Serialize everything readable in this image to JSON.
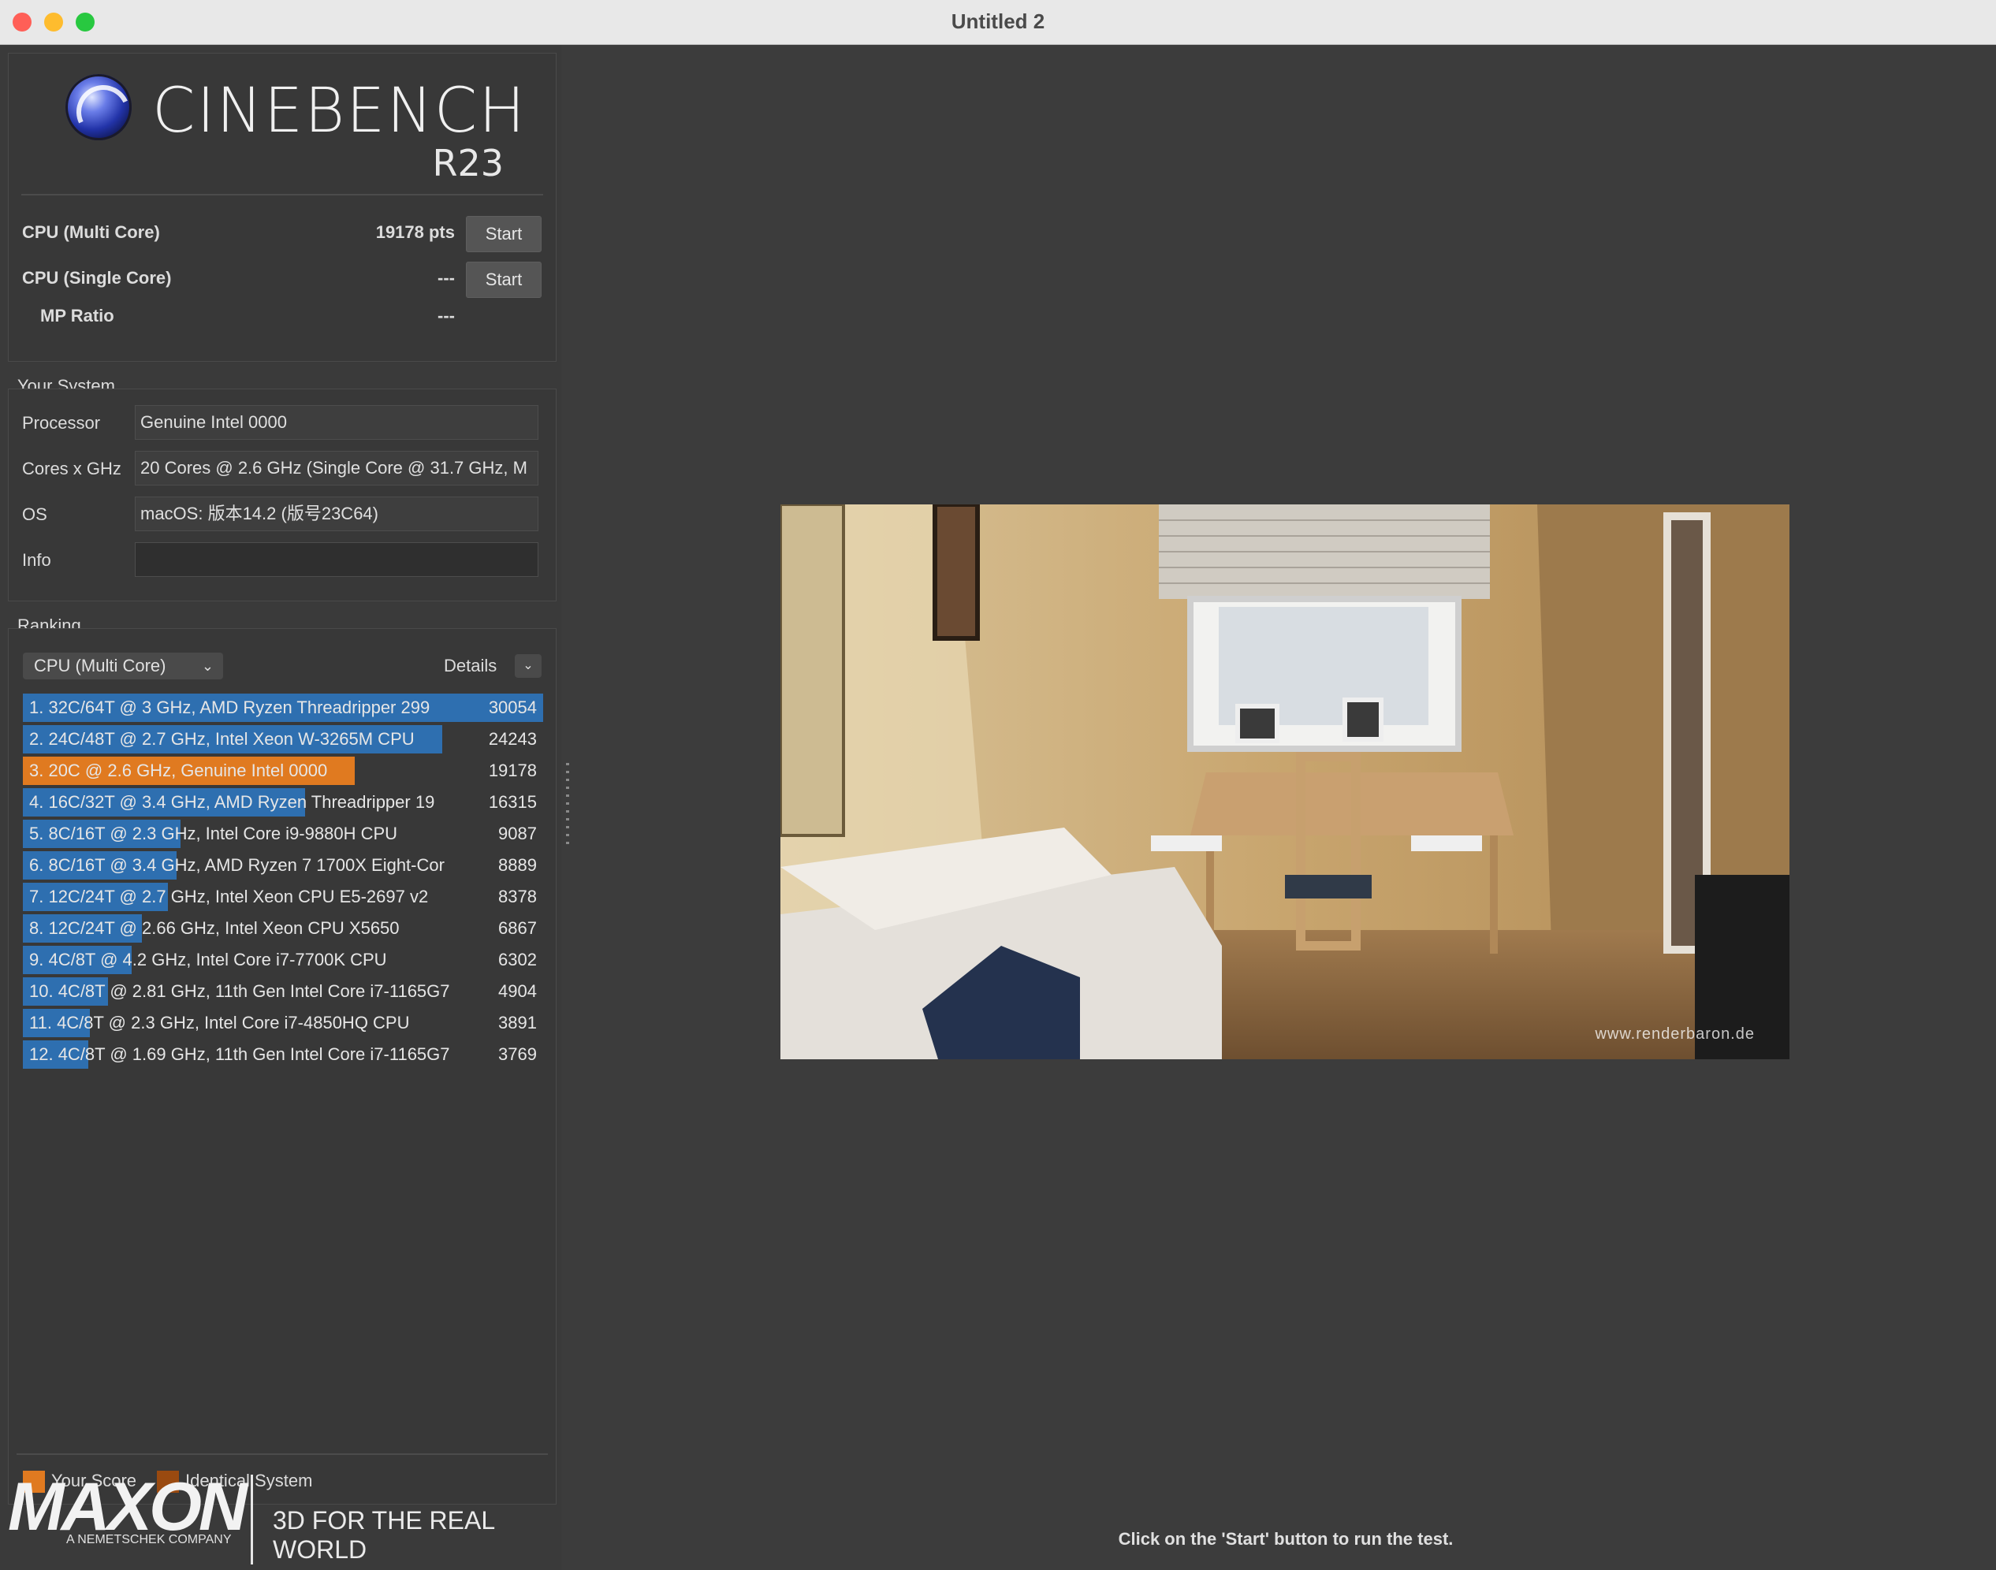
{
  "window": {
    "title": "Untitled 2"
  },
  "header": {
    "app_name": "CINEBENCH",
    "version": "R23"
  },
  "tests": {
    "multi": {
      "label": "CPU (Multi Core)",
      "value": "19178 pts",
      "button": "Start"
    },
    "single": {
      "label": "CPU (Single Core)",
      "value": "---",
      "button": "Start"
    },
    "mp_ratio": {
      "label": "MP Ratio",
      "value": "---"
    }
  },
  "system": {
    "title": "Your System",
    "fields": [
      {
        "label": "Processor",
        "value": "Genuine Intel 0000"
      },
      {
        "label": "Cores x GHz",
        "value": "20 Cores @ 2.6 GHz (Single Core @ 31.7 GHz, M"
      },
      {
        "label": "OS",
        "value": "macOS: 版本14.2 (版号23C64)"
      },
      {
        "label": "Info",
        "value": ""
      }
    ]
  },
  "ranking": {
    "title": "Ranking",
    "dropdown": "CPU (Multi Core)",
    "details_label": "Details",
    "max_score": 30054,
    "rows": [
      {
        "name": "1. 32C/64T @ 3 GHz, AMD Ryzen Threadripper 299",
        "score": 30054,
        "kind": "blue"
      },
      {
        "name": "2. 24C/48T @ 2.7 GHz, Intel Xeon W-3265M CPU",
        "score": 24243,
        "kind": "blue"
      },
      {
        "name": "3. 20C @ 2.6 GHz, Genuine Intel 0000",
        "score": 19178,
        "kind": "orange"
      },
      {
        "name": "4. 16C/32T @ 3.4 GHz, AMD Ryzen Threadripper 19",
        "score": 16315,
        "kind": "blue"
      },
      {
        "name": "5. 8C/16T @ 2.3 GHz, Intel Core i9-9880H CPU",
        "score": 9087,
        "kind": "blue"
      },
      {
        "name": "6. 8C/16T @ 3.4 GHz, AMD Ryzen 7 1700X Eight-Cor",
        "score": 8889,
        "kind": "blue"
      },
      {
        "name": "7. 12C/24T @ 2.7 GHz, Intel Xeon CPU E5-2697 v2",
        "score": 8378,
        "kind": "blue"
      },
      {
        "name": "8. 12C/24T @ 2.66 GHz, Intel Xeon CPU X5650",
        "score": 6867,
        "kind": "blue"
      },
      {
        "name": "9. 4C/8T @ 4.2 GHz, Intel Core i7-7700K CPU",
        "score": 6302,
        "kind": "blue"
      },
      {
        "name": "10. 4C/8T @ 2.81 GHz, 11th Gen Intel Core i7-1165G7",
        "score": 4904,
        "kind": "blue"
      },
      {
        "name": "11. 4C/8T @ 2.3 GHz, Intel Core i7-4850HQ CPU",
        "score": 3891,
        "kind": "blue"
      },
      {
        "name": "12. 4C/8T @ 1.69 GHz, 11th Gen Intel Core i7-1165G7",
        "score": 3769,
        "kind": "blue"
      }
    ],
    "legend": [
      {
        "label": "Your Score",
        "color": "#e07a20"
      },
      {
        "label": "Identical System",
        "color": "#9a4a10"
      }
    ]
  },
  "colors": {
    "bar_blue": "#2e6fb0",
    "bar_orange": "#e07a20",
    "panel": "#3a3a3a"
  },
  "footer": {
    "brand": "MAXON",
    "company": "A NEMETSCHEK COMPANY",
    "tagline": "3D FOR THE REAL WORLD"
  },
  "render": {
    "watermark": "www.renderbaron.de"
  },
  "status": "Click on the 'Start' button to run the test."
}
